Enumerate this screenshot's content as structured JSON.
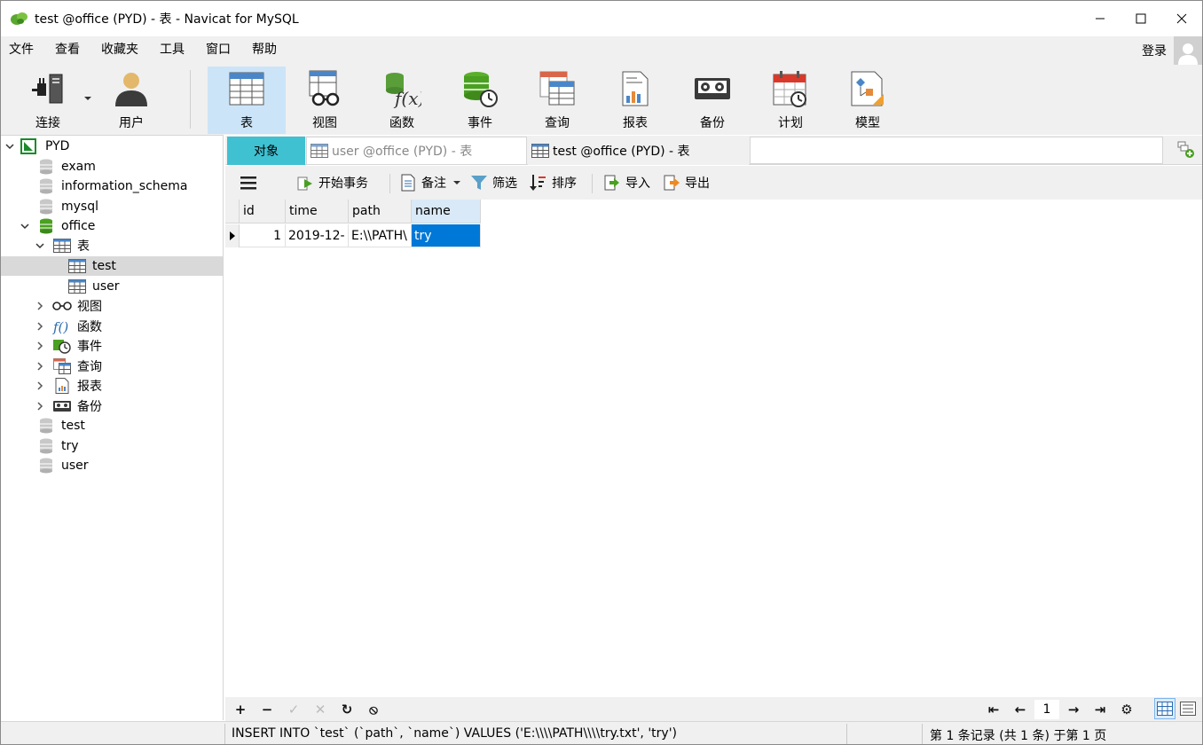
{
  "window": {
    "title": "test @office (PYD) - 表 - Navicat for MySQL"
  },
  "menu": [
    "文件",
    "查看",
    "收藏夹",
    "工具",
    "窗口",
    "帮助"
  ],
  "login_label": "登录",
  "toolbar": {
    "connect": "连接",
    "user": "用户",
    "table": "表",
    "view": "视图",
    "function": "函数",
    "event": "事件",
    "query": "查询",
    "report": "报表",
    "backup": "备份",
    "schedule": "计划",
    "model": "模型"
  },
  "tree": {
    "connection": "PYD",
    "databases": [
      "exam",
      "information_schema",
      "mysql",
      "office",
      "test",
      "try",
      "user"
    ],
    "office_children": {
      "tables_label": "表",
      "tables": [
        "test",
        "user"
      ],
      "views": "视图",
      "functions": "函数",
      "events": "事件",
      "queries": "查询",
      "reports": "报表",
      "backups": "备份"
    }
  },
  "tabs": {
    "objects": "对象",
    "user_tab": "user @office (PYD) - 表",
    "test_tab": "test @office (PYD) - 表"
  },
  "subtoolbar": {
    "begin_transaction": "开始事务",
    "notes": "备注",
    "filter": "筛选",
    "sort": "排序",
    "import": "导入",
    "export": "导出"
  },
  "grid": {
    "columns": [
      "id",
      "time",
      "path",
      "name"
    ],
    "rows": [
      {
        "id": "1",
        "time": "2019-12-",
        "path": "E:\\\\PATH\\",
        "name": "try"
      }
    ]
  },
  "navbar": {
    "page": "1"
  },
  "status": {
    "sql": "INSERT INTO `test` (`path`, `name`) VALUES ('E:\\\\\\\\PATH\\\\\\\\try.txt', 'try')",
    "records": "第 1 条记录 (共 1 条) 于第 1 页"
  },
  "colors": {
    "active_tab": "#3fc1d2",
    "toolbar_active": "#cce4f7",
    "selected_cell": "#0078d7"
  }
}
